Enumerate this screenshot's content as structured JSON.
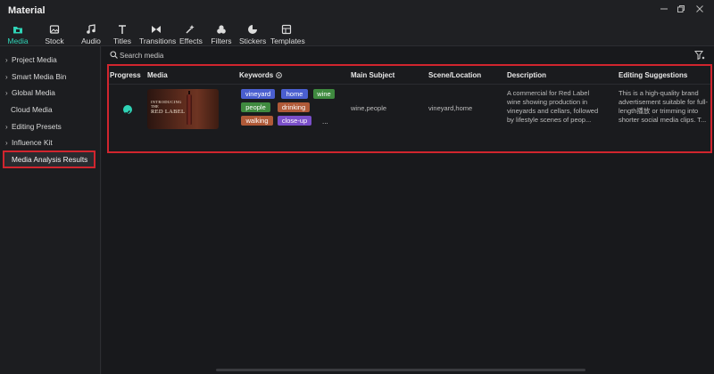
{
  "app": {
    "title": "Material"
  },
  "toolbar": {
    "items": [
      {
        "label": "Media",
        "icon": "media-folder-icon",
        "active": true
      },
      {
        "label": "Stock Media",
        "icon": "stock-media-icon"
      },
      {
        "label": "Audio",
        "icon": "music-note-icon"
      },
      {
        "label": "Titles",
        "icon": "text-t-icon"
      },
      {
        "label": "Transitions",
        "icon": "transition-icon"
      },
      {
        "label": "Effects",
        "icon": "effects-icon"
      },
      {
        "label": "Filters",
        "icon": "filters-icon"
      },
      {
        "label": "Stickers",
        "icon": "stickers-icon"
      },
      {
        "label": "Templates",
        "icon": "templates-icon"
      }
    ],
    "accent_color": "#2fd3b6"
  },
  "sidebar": {
    "items": [
      {
        "label": "Project Media",
        "expandable": true
      },
      {
        "label": "Smart Media Bin",
        "expandable": true
      },
      {
        "label": "Global Media",
        "expandable": true
      },
      {
        "label": "Cloud Media",
        "expandable": false
      },
      {
        "label": "Editing Presets",
        "expandable": true
      },
      {
        "label": "Influence Kit",
        "expandable": true
      },
      {
        "label": "Media Analysis Results",
        "expandable": false,
        "selected": true
      }
    ]
  },
  "search": {
    "placeholder": "Search media"
  },
  "table": {
    "headers": {
      "progress": "Progress",
      "media": "Media",
      "keywords": "Keywords",
      "main_subject": "Main Subject",
      "scene": "Scene/Location",
      "description": "Description",
      "suggestions": "Editing Suggestions"
    },
    "rows": [
      {
        "progress_status": "complete",
        "thumbnail": {
          "line1": "INTRODUCING",
          "line2": "THE",
          "line3": "RED LABEL"
        },
        "keywords": [
          {
            "text": "vineyard",
            "color": "#4a5fd0"
          },
          {
            "text": "home",
            "color": "#4a5fd0"
          },
          {
            "text": "wine",
            "color": "#3f8a3f"
          },
          {
            "text": "people",
            "color": "#3f8a3f"
          },
          {
            "text": "drinking",
            "color": "#b05a38"
          },
          {
            "text": "walking",
            "color": "#b05a38"
          },
          {
            "text": "close-up",
            "color": "#7a4fc9"
          }
        ],
        "more_indicator": "...",
        "main_subject": "wine,people",
        "scene": "vineyard,home",
        "description_lines": [
          "A commercial for Red Label",
          "wine showing production in",
          "vineyards and cellars, followed",
          "by lifestyle scenes of peop..."
        ],
        "suggestion_lines": [
          "This is a high-quality brand",
          "advertisement suitable for full-",
          "length播放 or trimming into",
          "shorter social media clips. T..."
        ]
      }
    ]
  },
  "highlight_color": "#d1252e"
}
